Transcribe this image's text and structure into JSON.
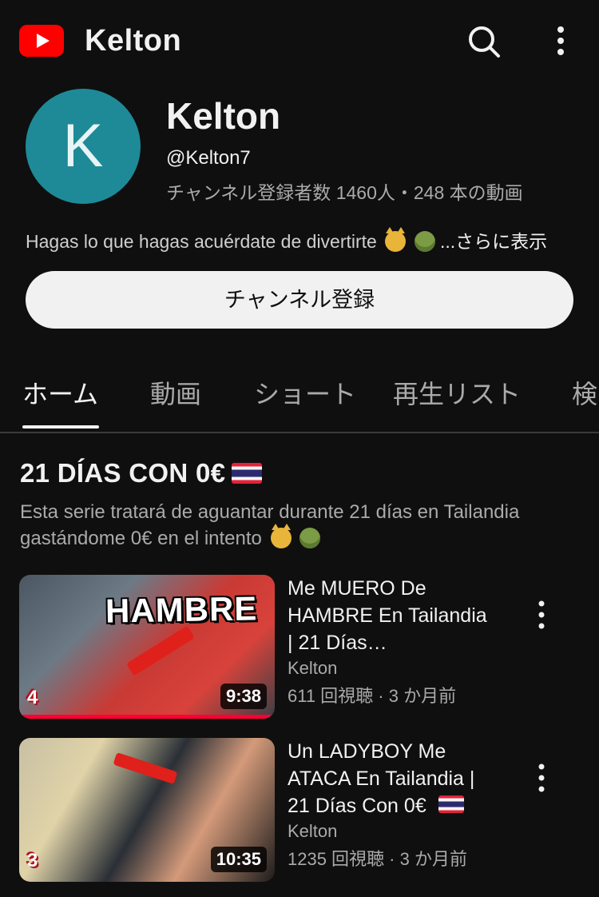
{
  "app": {
    "title": "Kelton"
  },
  "channel": {
    "avatar_letter": "K",
    "name": "Kelton",
    "handle": "@Kelton7",
    "stats": "チャンネル登録者数 1460人・248 本の動画",
    "description": "Hagas lo que hagas acuérdate de divertirte",
    "more_label": "...さらに表示",
    "subscribe_label": "チャンネル登録",
    "avatar_color": "#1e8a97"
  },
  "tabs": [
    {
      "label": "ホーム",
      "active": true
    },
    {
      "label": "動画"
    },
    {
      "label": "ショート"
    },
    {
      "label": "再生リスト"
    },
    {
      "label": "検"
    }
  ],
  "section": {
    "title": "21 DÍAS CON 0€",
    "description_line1": "Esta serie tratará de aguantar durante 21 días en Tailandia",
    "description_line2": "gastándome 0€ en el intento"
  },
  "videos": [
    {
      "title": "Me MUERO De HAMBRE En Tailandia | 21 Días…",
      "thumb_text": "HAMBRE",
      "episode": "4",
      "duration": "9:38",
      "channel": "Kelton",
      "meta": "611 回視聴 · 3 か月前",
      "watched_fraction": 1.0
    },
    {
      "title": "Un LADYBOY Me ATACA En Tailandia | 21 Días Con 0€",
      "episode": "3",
      "duration": "10:35",
      "channel": "Kelton",
      "meta": "1235 回視聴 · 3 か月前",
      "watched_fraction": 0.0
    }
  ],
  "colors": {
    "background": "#0f0f0f",
    "brand_red": "#ff0000",
    "progress_red": "#ff0033"
  },
  "icons": [
    "youtube-logo-icon",
    "search-icon",
    "more-vert-icon",
    "thailand-flag-icon"
  ]
}
